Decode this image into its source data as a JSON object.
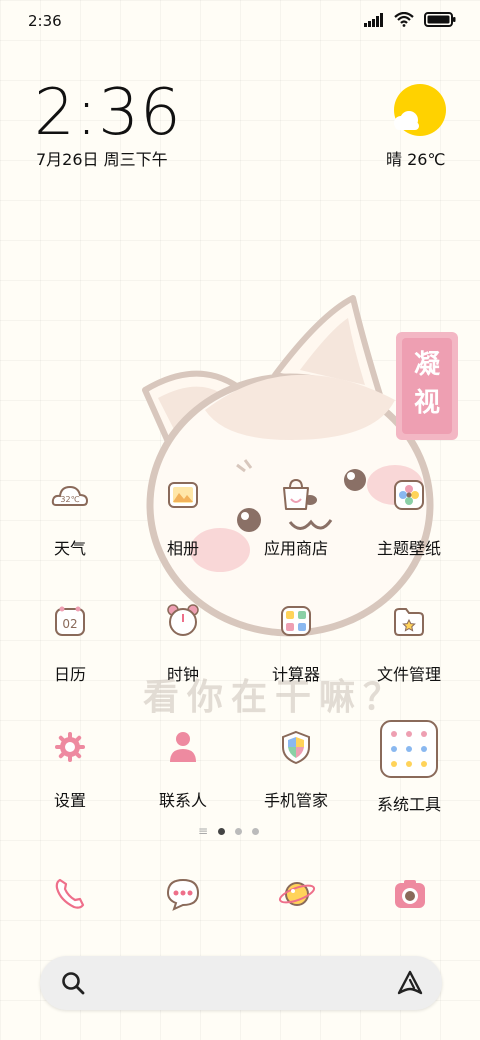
{
  "status_bar": {
    "time": "2:36"
  },
  "clock": {
    "time": "2:36",
    "date": "7月26日 周三下午"
  },
  "weather": {
    "text": "晴 26℃",
    "widget_temp": "32℃"
  },
  "wallpaper": {
    "badge": "凝视",
    "slogan": "看你在干嘛？"
  },
  "apps": [
    {
      "label": "天气",
      "icon": "weather-cloud-icon"
    },
    {
      "label": "相册",
      "icon": "gallery-icon"
    },
    {
      "label": "应用商店",
      "icon": "app-store-bag-icon"
    },
    {
      "label": "主题壁纸",
      "icon": "themes-flower-icon"
    },
    {
      "label": "日历",
      "icon": "calendar-icon",
      "day": "02"
    },
    {
      "label": "时钟",
      "icon": "alarm-clock-icon"
    },
    {
      "label": "计算器",
      "icon": "calculator-icon"
    },
    {
      "label": "文件管理",
      "icon": "file-folder-icon"
    },
    {
      "label": "设置",
      "icon": "gear-icon"
    },
    {
      "label": "联系人",
      "icon": "contacts-person-icon"
    },
    {
      "label": "手机管家",
      "icon": "security-shield-icon"
    },
    {
      "label": "系统工具",
      "icon": "system-tools-folder-icon"
    }
  ],
  "page_indicator": {
    "pages": 3,
    "active": 0
  },
  "dock": [
    {
      "icon": "phone-icon"
    },
    {
      "icon": "messages-icon"
    },
    {
      "icon": "browser-planet-icon"
    },
    {
      "icon": "camera-icon"
    }
  ],
  "colors": {
    "accent_pink": "#ee9fb2",
    "outline_brown": "#8a6a5a",
    "weather_sun": "#ffd200"
  }
}
